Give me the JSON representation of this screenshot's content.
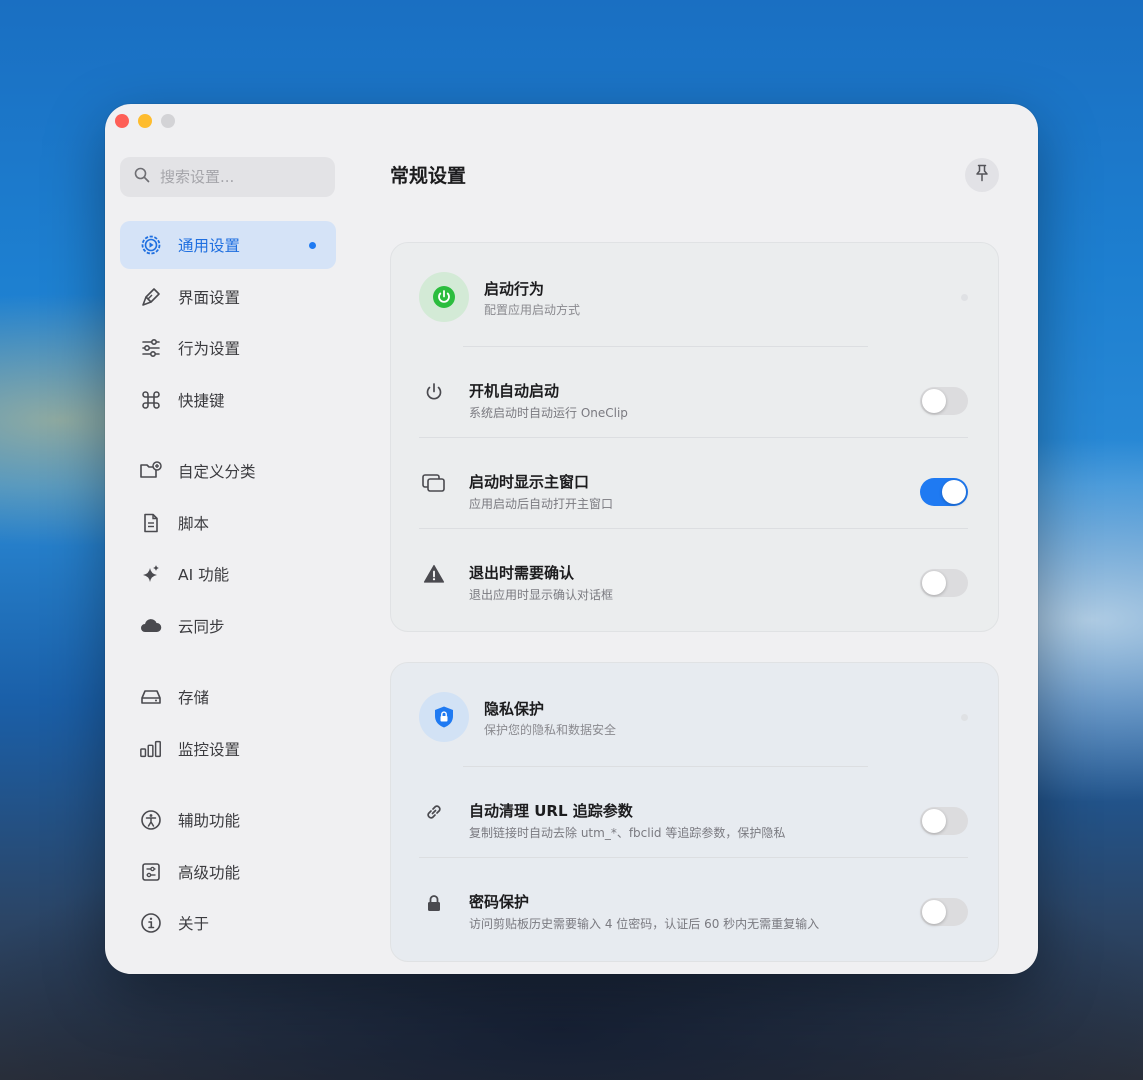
{
  "window": {
    "title": "常规设置"
  },
  "search": {
    "placeholder": "搜索设置..."
  },
  "sidebar": {
    "groups": [
      [
        {
          "label": "通用设置",
          "icon": "gear-icon",
          "active": true
        },
        {
          "label": "界面设置",
          "icon": "brush-icon"
        },
        {
          "label": "行为设置",
          "icon": "sliders-icon"
        },
        {
          "label": "快捷键",
          "icon": "command-icon"
        }
      ],
      [
        {
          "label": "自定义分类",
          "icon": "folder-add-icon"
        },
        {
          "label": "脚本",
          "icon": "document-icon"
        },
        {
          "label": "AI 功能",
          "icon": "sparkles-icon"
        },
        {
          "label": "云同步",
          "icon": "cloud-icon"
        }
      ],
      [
        {
          "label": "存储",
          "icon": "drive-icon"
        },
        {
          "label": "监控设置",
          "icon": "bar-chart-icon"
        }
      ],
      [
        {
          "label": "辅助功能",
          "icon": "accessibility-icon"
        },
        {
          "label": "高级功能",
          "icon": "advanced-icon"
        },
        {
          "label": "关于",
          "icon": "info-icon"
        }
      ]
    ]
  },
  "cards": {
    "startup": {
      "title": "启动行为",
      "subtitle": "配置应用启动方式",
      "icon": "power-icon",
      "rows": [
        {
          "title": "开机自动启动",
          "subtitle": "系统启动时自动运行 OneClip",
          "icon": "power-icon",
          "enabled": false
        },
        {
          "title": "启动时显示主窗口",
          "subtitle": "应用启动后自动打开主窗口",
          "icon": "windows-icon",
          "enabled": true
        },
        {
          "title": "退出时需要确认",
          "subtitle": "退出应用时显示确认对话框",
          "icon": "warning-icon",
          "enabled": false
        }
      ]
    },
    "privacy": {
      "title": "隐私保护",
      "subtitle": "保护您的隐私和数据安全",
      "icon": "shield-lock-icon",
      "rows": [
        {
          "title": "自动清理 URL 追踪参数",
          "subtitle": "复制链接时自动去除 utm_*、fbclid 等追踪参数，保护隐私",
          "icon": "link-icon",
          "enabled": false
        },
        {
          "title": "密码保护",
          "subtitle": "访问剪贴板历史需要输入 4 位密码，认证后 60 秒内无需重复输入",
          "icon": "lock-icon",
          "enabled": false
        }
      ]
    }
  },
  "colors": {
    "accent": "#1f7af2",
    "active_bg": "#d5e3f7",
    "power_green": "#2bbd3e"
  }
}
